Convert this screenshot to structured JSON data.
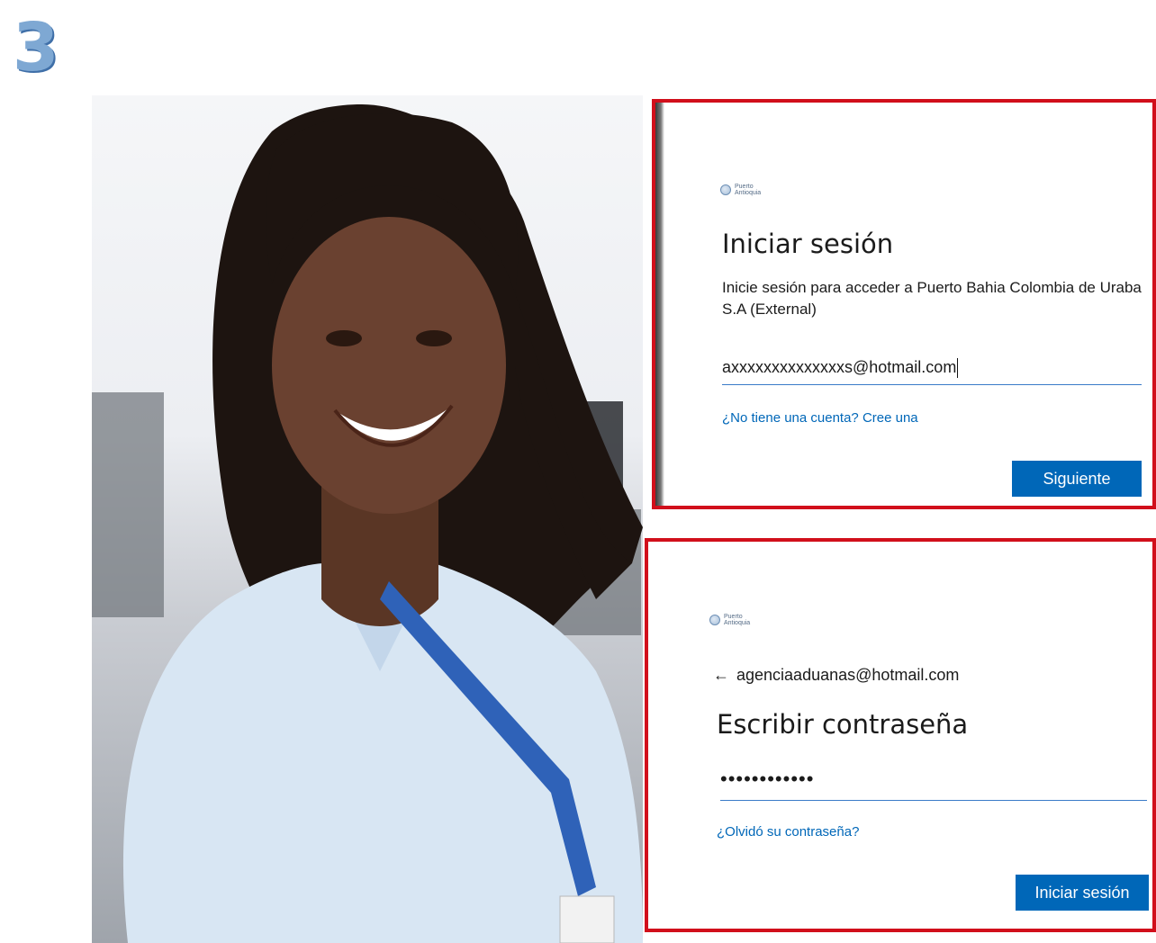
{
  "step_number": "3",
  "photo": {
    "alt": "Mujer sonriente con camisa azul claro y cinta de carnet"
  },
  "signin_panel": {
    "org_name": "Puerto Antioquia",
    "title": "Iniciar sesión",
    "subtitle": "Inicie sesión para acceder a Puerto Bahia Colombia de Uraba S.A (External)",
    "email_value": "axxxxxxxxxxxxxxs@hotmail.com",
    "create_account_link": "¿No tiene una cuenta? Cree una",
    "next_button": "Siguiente"
  },
  "password_panel": {
    "org_name": "Puerto Antioquia",
    "back_arrow": "←",
    "account_email": "agenciaaduanas@hotmail.com",
    "title": "Escribir contraseña",
    "password_mask": "••••••••••••",
    "forgot_link": "¿Olvidó su contraseña?",
    "signin_button": "Iniciar sesión"
  },
  "colors": {
    "accent": "#0067b8",
    "highlight_border": "#d10f1b",
    "step_number": "#7ea8d3"
  }
}
